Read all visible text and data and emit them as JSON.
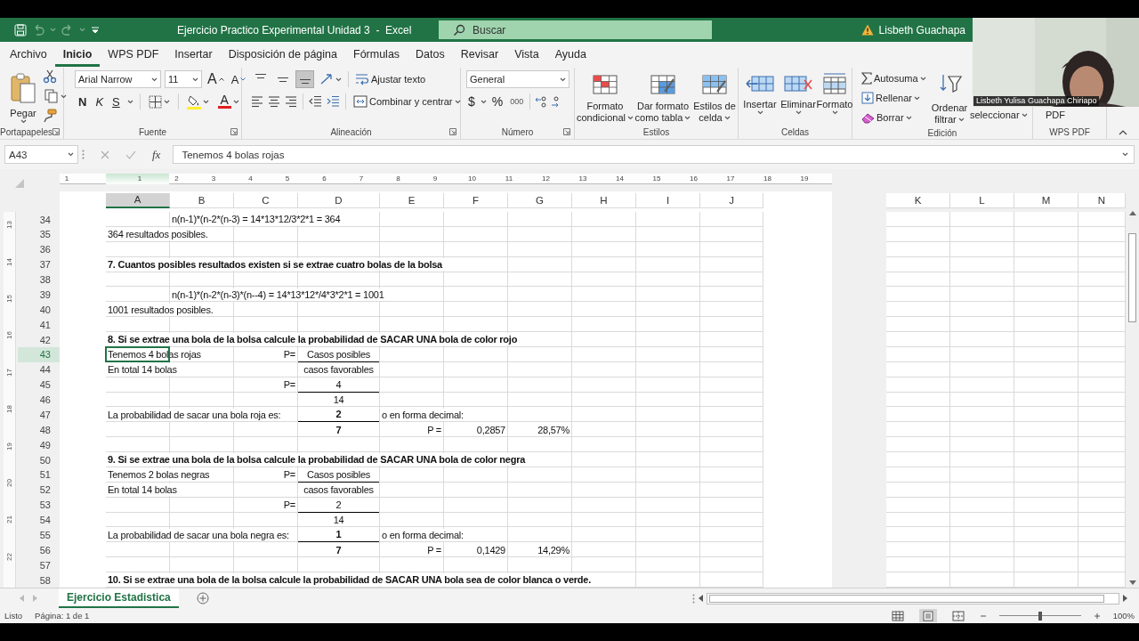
{
  "title_bar": {
    "title": "Ejercicio Practico Experimental Unidad 3  -  Excel",
    "search_placeholder": "Buscar",
    "user": "Lisbeth Guachapa"
  },
  "menu_tabs": [
    {
      "label": "Archivo",
      "selected": false
    },
    {
      "label": "Inicio",
      "selected": true
    },
    {
      "label": "WPS PDF",
      "selected": false
    },
    {
      "label": "Insertar",
      "selected": false
    },
    {
      "label": "Disposición de página",
      "selected": false
    },
    {
      "label": "Fórmulas",
      "selected": false
    },
    {
      "label": "Datos",
      "selected": false
    },
    {
      "label": "Revisar",
      "selected": false
    },
    {
      "label": "Vista",
      "selected": false
    },
    {
      "label": "Ayuda",
      "selected": false
    }
  ],
  "ribbon": {
    "clipboard": {
      "label": "Portapapeles",
      "paste": "Pegar"
    },
    "font": {
      "label": "Fuente",
      "font_name": "Arial Narrow",
      "font_size": "11",
      "grow": "A",
      "shrink": "A",
      "bold": "N",
      "italic": "K",
      "underline": "S",
      "font_color": "A"
    },
    "alignment": {
      "label": "Alineación",
      "vertical": [
        {
          "selected": false
        },
        {
          "selected": false
        },
        {
          "selected": true
        }
      ],
      "wrap": "Ajustar texto",
      "merge": "Combinar y centrar"
    },
    "number": {
      "label": "Número",
      "format": "General",
      "currency": "$",
      "percent": "%",
      "thousands": "000"
    },
    "styles": {
      "label": "Estilos",
      "buttons": [
        [
          "Formato",
          "condicional"
        ],
        [
          "Dar formato",
          "como tabla"
        ],
        [
          "Estilos de",
          "celda"
        ]
      ]
    },
    "cells": {
      "label": "Celdas",
      "buttons": [
        "Insertar",
        "Eliminar",
        "Formato"
      ]
    },
    "editing": {
      "label": "Edición",
      "autosum": "Autosuma",
      "fill": "Rellenar",
      "clear": "Borrar",
      "sort": [
        "Ordenar",
        "filtrar"
      ],
      "find": "seleccionar"
    },
    "wps": {
      "label": "WPS PDF",
      "button": "PDF"
    }
  },
  "formula_bar": {
    "name_box": "A43",
    "fx": "fx",
    "formula": "Tenemos 4 bolas rojas"
  },
  "ruler": [
    "1",
    "1",
    "2",
    "3",
    "4",
    "5",
    "6",
    "7",
    "8",
    "9",
    "10",
    "11",
    "12",
    "13",
    "14",
    "15",
    "16",
    "17",
    "18",
    "19"
  ],
  "vertical_ruler": [
    "13",
    "14",
    "15",
    "16",
    "17",
    "18",
    "19",
    "20",
    "21",
    "22"
  ],
  "columns": [
    "A",
    "B",
    "C",
    "D",
    "E",
    "F",
    "G",
    "H",
    "I",
    "J"
  ],
  "columns_next_page": [
    "K",
    "L",
    "M",
    "N"
  ],
  "rows": [
    {
      "number": "34",
      "B": {
        "kind": "text",
        "text": "n(n-1)*(n-2*(n-3) = 14*13*12/3*2*1 = 364",
        "bold": false,
        "underline": false,
        "selected": false
      }
    },
    {
      "number": "35",
      "A": {
        "kind": "text",
        "text": "364 resultados posibles.",
        "bold": false,
        "underline": false,
        "selected": false
      }
    },
    {
      "number": "36"
    },
    {
      "number": "37",
      "A": {
        "kind": "text",
        "text": "7. Cuantos posibles resultados existen si se extrae cuatro bolas de la bolsa",
        "bold": true,
        "underline": false,
        "selected": false
      }
    },
    {
      "number": "38"
    },
    {
      "number": "39",
      "B": {
        "kind": "text",
        "text": "n(n-1)*(n-2*(n-3)*(n--4) = 14*13*12*/4*3*2*1 = 1001",
        "bold": false,
        "underline": false,
        "selected": false
      }
    },
    {
      "number": "40",
      "A": {
        "kind": "text",
        "text": "1001 resultados posibles.",
        "bold": false,
        "underline": false,
        "selected": false
      }
    },
    {
      "number": "41"
    },
    {
      "number": "42",
      "A": {
        "kind": "text",
        "text": "8. Si se extrae una bola de la bolsa calcule la probabilidad de SACAR UNA bola de color rojo",
        "bold": true,
        "underline": false,
        "selected": false
      }
    },
    {
      "number": "43",
      "A": {
        "kind": "text",
        "text": "Tenemos 4 bolas rojas",
        "bold": false,
        "underline": false,
        "selected": true
      },
      "C": {
        "kind": "sign",
        "text": "P=",
        "bold": false,
        "underline": false,
        "selected": false
      },
      "D": {
        "kind": "fraction",
        "text": "Casos posibles",
        "bold": false,
        "underline": true,
        "selected": false
      }
    },
    {
      "number": "44",
      "A": {
        "kind": "text",
        "text": "En total 14 bolas",
        "bold": false,
        "underline": false,
        "selected": false
      },
      "D": {
        "kind": "fraction",
        "text": "casos favorables",
        "bold": false,
        "underline": false,
        "selected": false
      }
    },
    {
      "number": "45",
      "C": {
        "kind": "sign",
        "text": "P=",
        "bold": false,
        "underline": false,
        "selected": false
      },
      "D": {
        "kind": "fraction",
        "text": "4",
        "bold": false,
        "underline": true,
        "selected": false
      }
    },
    {
      "number": "46",
      "D": {
        "kind": "fraction",
        "text": "14",
        "bold": false,
        "underline": false,
        "selected": false
      }
    },
    {
      "number": "47",
      "A": {
        "kind": "text",
        "text": "La probabilidad de sacar una bola roja es:",
        "bold": false,
        "underline": false,
        "selected": false
      },
      "D": {
        "kind": "fraction",
        "text": "2",
        "bold": true,
        "underline": true,
        "selected": false
      },
      "E": {
        "kind": "text",
        "text": "o en forma decimal:",
        "bold": false,
        "underline": false,
        "selected": false
      }
    },
    {
      "number": "48",
      "D": {
        "kind": "fraction",
        "text": "7",
        "bold": true,
        "underline": false,
        "selected": false
      },
      "E": {
        "kind": "sign",
        "text": "P =",
        "bold": false,
        "underline": false,
        "selected": false
      },
      "F": {
        "kind": "number",
        "text": "0,2857",
        "bold": false,
        "underline": false,
        "selected": false
      },
      "G": {
        "kind": "number",
        "text": "28,57%",
        "bold": false,
        "underline": false,
        "selected": false
      }
    },
    {
      "number": "49"
    },
    {
      "number": "50",
      "A": {
        "kind": "text",
        "text": "9. Si se extrae una bola de la bolsa calcule la probabilidad de SACAR UNA bola de color negra",
        "bold": true,
        "underline": false,
        "selected": false
      }
    },
    {
      "number": "51",
      "A": {
        "kind": "text",
        "text": "Tenemos 2 bolas negras",
        "bold": false,
        "underline": false,
        "selected": false
      },
      "C": {
        "kind": "sign",
        "text": "P=",
        "bold": false,
        "underline": false,
        "selected": false
      },
      "D": {
        "kind": "fraction",
        "text": "Casos posibles",
        "bold": false,
        "underline": true,
        "selected": false
      }
    },
    {
      "number": "52",
      "A": {
        "kind": "text",
        "text": "En total 14 bolas",
        "bold": false,
        "underline": false,
        "selected": false
      },
      "D": {
        "kind": "fraction",
        "text": "casos favorables",
        "bold": false,
        "underline": false,
        "selected": false
      }
    },
    {
      "number": "53",
      "C": {
        "kind": "sign",
        "text": "P=",
        "bold": false,
        "underline": false,
        "selected": false
      },
      "D": {
        "kind": "fraction",
        "text": "2",
        "bold": false,
        "underline": true,
        "selected": false
      }
    },
    {
      "number": "54",
      "D": {
        "kind": "fraction",
        "text": "14",
        "bold": false,
        "underline": false,
        "selected": false
      }
    },
    {
      "number": "55",
      "A": {
        "kind": "text",
        "text": "La probabilidad de sacar una bola negra es:",
        "bold": false,
        "underline": false,
        "selected": false
      },
      "D": {
        "kind": "fraction",
        "text": "1",
        "bold": true,
        "underline": true,
        "selected": false
      },
      "E": {
        "kind": "text",
        "text": "o en forma decimal:",
        "bold": false,
        "underline": false,
        "selected": false
      }
    },
    {
      "number": "56",
      "D": {
        "kind": "fraction",
        "text": "7",
        "bold": true,
        "underline": false,
        "selected": false
      },
      "E": {
        "kind": "sign",
        "text": "P =",
        "bold": false,
        "underline": false,
        "selected": false
      },
      "F": {
        "kind": "number",
        "text": "0,1429",
        "bold": false,
        "underline": false,
        "selected": false
      },
      "G": {
        "kind": "number",
        "text": "14,29%",
        "bold": false,
        "underline": false,
        "selected": false
      }
    },
    {
      "number": "57"
    },
    {
      "number": "58",
      "A": {
        "kind": "text",
        "text": "10. Si se extrae una bola de la bolsa calcule la probabilidad de SACAR UNA bola sea de color blanca o verde.",
        "bold": true,
        "underline": false,
        "selected": false
      }
    }
  ],
  "sheet_tabs": [
    {
      "label": "Ejercicio Estadistica",
      "selected": true
    }
  ],
  "status_bar": {
    "status": "Listo",
    "page": "Página: 1 de 1",
    "views": [
      {
        "selected": false
      },
      {
        "selected": true
      },
      {
        "selected": false
      }
    ],
    "zoom": {
      "level": 0.5
    },
    "zoom_text": "100%"
  },
  "webcam": {
    "caption": "Lisbeth Yulisa Guachapa Chiriapo"
  }
}
